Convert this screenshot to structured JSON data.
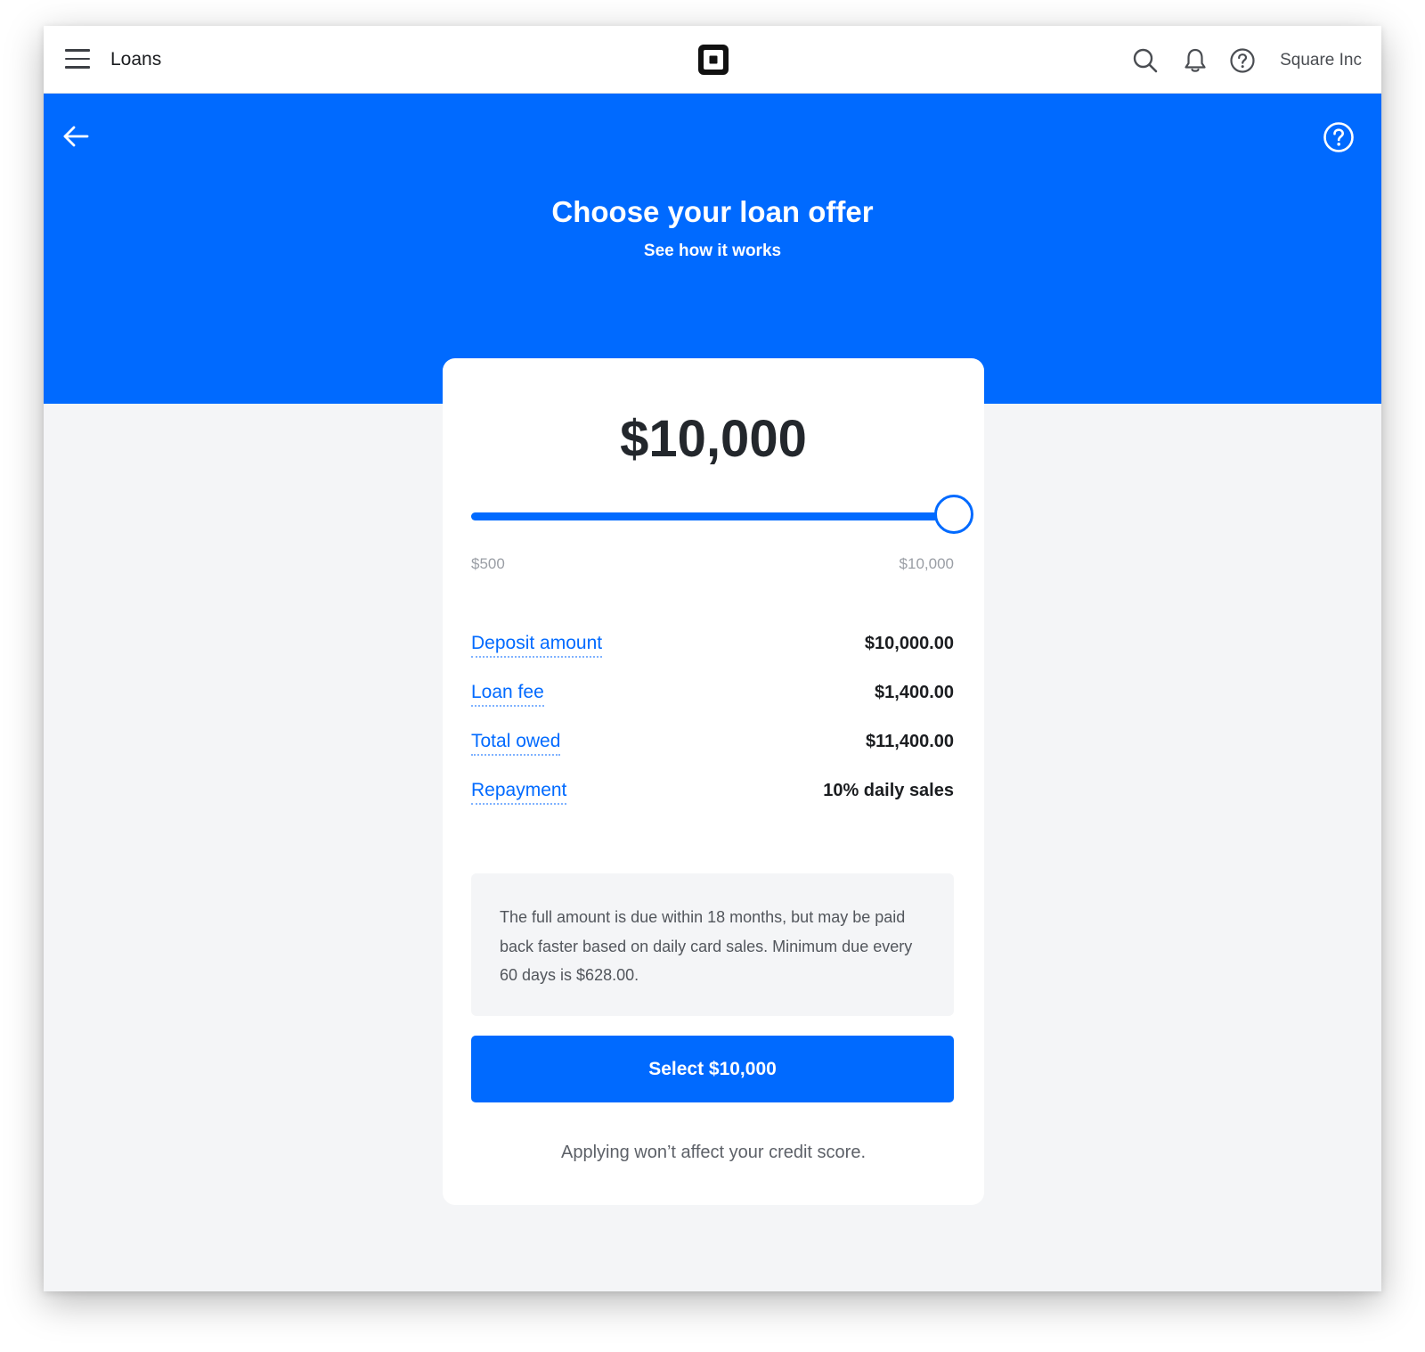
{
  "topbar": {
    "menu_icon": "hamburger-menu-icon",
    "title": "Loans",
    "logo_icon": "square-logo-icon",
    "search_icon": "search-icon",
    "notifications_icon": "bell-icon",
    "help_icon": "help-circle-icon",
    "account_name": "Square Inc"
  },
  "banner": {
    "back_icon": "arrow-left-icon",
    "help_icon": "help-circle-icon",
    "title": "Choose your loan offer",
    "link": "See how it works",
    "color": "#006aff"
  },
  "offer": {
    "amount": "$10,000",
    "slider": {
      "min_label": "$500",
      "max_label": "$10,000",
      "min": 500,
      "max": 10000,
      "value": 10000
    },
    "details": [
      {
        "label": "Deposit amount",
        "value": "$10,000.00"
      },
      {
        "label": "Loan fee",
        "value": "$1,400.00"
      },
      {
        "label": "Total owed",
        "value": "$11,400.00"
      },
      {
        "label": "Repayment",
        "value": "10% daily sales"
      }
    ],
    "info_text": "The full amount is due within 18 months, but may be paid back faster based on daily card sales. Minimum due every 60 days is $628.00.",
    "select_button": "Select $10,000",
    "footnote": "Applying won’t affect your credit score."
  }
}
